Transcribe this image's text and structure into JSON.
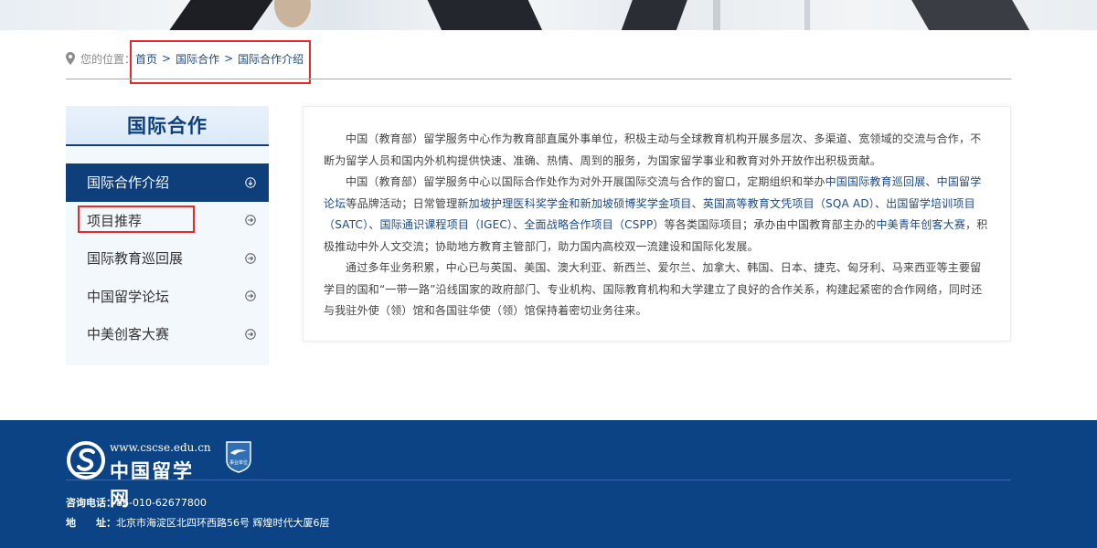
{
  "breadcrumb": {
    "prefix": "您的位置：",
    "items": [
      "首页",
      "国际合作",
      "国际合作介绍"
    ],
    "separator": ">"
  },
  "sidebar": {
    "title": "国际合作",
    "items": [
      {
        "label": "国际合作介绍",
        "active": true
      },
      {
        "label": "项目推荐",
        "active": false
      },
      {
        "label": "国际教育巡回展",
        "active": false
      },
      {
        "label": "中国留学论坛",
        "active": false
      },
      {
        "label": "中美创客大赛",
        "active": false
      }
    ]
  },
  "content": {
    "p1": "中国（教育部）留学服务中心作为教育部直属外事单位，积极主动与全球教育机构开展多层次、多渠道、宽领域的交流与合作，不断为留学人员和国内外机构提供快速、准确、热情、周到的服务，为国家留学事业和教育对外开放作出积极贡献。",
    "p2": {
      "t1": "中国（教育部）留学服务中心以国际合作处作为对外开展国际交流与合作的窗口，定期组织和举办",
      "l1": "中国国际教育巡回展",
      "t2": "、",
      "l2": "中国留学论坛",
      "t3": "等品牌活动；日常管理",
      "l3": "新加坡护理医科奖学金和新加坡硕博奖学金项目",
      "t4": "、",
      "l4": "英国高等教育文凭项目（SQA AD）",
      "t5": "、",
      "l5": "出国留学培训项目（SATC）",
      "t6": "、",
      "l6": "国际通识课程项目（IGEC）",
      "t7": "、",
      "l7": "全面战略合作项目（CSPP）",
      "t8": "等各类国际项目；承办由中国教育部主办的",
      "l8": "中美青年创客大赛",
      "t9": "，积极推动中外人文交流；协助地方教育主管部门，助力国内高校双一流建设和国际化发展。"
    },
    "p3": "通过多年业务积累，中心已与英国、美国、澳大利亚、新西兰、爱尔兰、加拿大、韩国、日本、捷克、匈牙利、马来西亚等主要留学目的国和“一带一路”沿线国家的政府部门、专业机构、国际教育机构和大学建立了良好的合作关系，构建起紧密的合作网络，同时还与我驻外使（领）馆和各国驻华使（领）馆保持着密切业务往来。"
  },
  "footer": {
    "logo_url": "www.cscse.edu.cn",
    "logo_name": "中国留学网",
    "badge_text": "事业单位",
    "phone_label": "咨询电话：",
    "phone": "86-010-62677800",
    "address_label": "地　　址：",
    "address": "北京市海淀区北四环西路56号 辉煌时代大厦6层"
  },
  "colors": {
    "brand": "#0f3f7b",
    "link": "#1c4a86",
    "highlight": "#e8282a",
    "footer_bg": "#0b4385"
  }
}
